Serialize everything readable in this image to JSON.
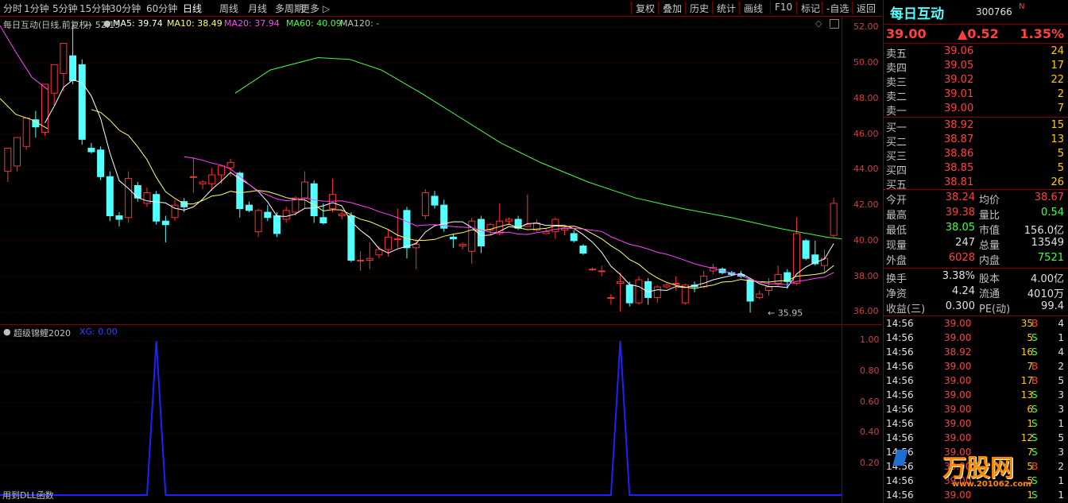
{
  "toolbar": {
    "periods": [
      "分时",
      "1分钟",
      "5分钟",
      "15分钟",
      "30分钟",
      "60分钟",
      "日线",
      "周线",
      "月线",
      "多周期",
      "更多 ▷"
    ],
    "tools": [
      "复权",
      "叠加",
      "历史",
      "统计",
      "画线",
      "F10",
      "标记",
      "-自选",
      "返回"
    ]
  },
  "main_chart": {
    "title": "每日互动(日线,前复权)",
    "ma": [
      {
        "label": "MA5: 39.74",
        "color": "#ffffff"
      },
      {
        "label": "MA10: 38.49",
        "color": "#ffff66"
      },
      {
        "label": "MA20: 37.94",
        "color": "#ff44ff"
      },
      {
        "label": "MA60: 40.09",
        "color": "#44ff44"
      },
      {
        "label": "MA120: -",
        "color": "#c0c0c0"
      }
    ],
    "price_ticks": [
      "52.00",
      "50.00",
      "48.00",
      "46.00",
      "44.00",
      "42.00",
      "40.00",
      "38.00",
      "36.00"
    ],
    "high_marker": "52.15",
    "low_marker": "35.95",
    "colors": {
      "up": "#ff3030",
      "down": "#54ffff",
      "ma5": "#ffffff",
      "ma10": "#ffff66",
      "ma20": "#ff44ff",
      "ma60": "#44ff44"
    }
  },
  "chart_data": {
    "type": "line",
    "title": "",
    "series": [
      {
        "name": "XG",
        "x": [
          1,
          2,
          3,
          4,
          5,
          6,
          7,
          8,
          9,
          10,
          11,
          12,
          13,
          14,
          15,
          16,
          17,
          18,
          19,
          20,
          21,
          22,
          23,
          24,
          25,
          26,
          27,
          28,
          29,
          30,
          31,
          32,
          33,
          34,
          35,
          36,
          37,
          38,
          39,
          40,
          41,
          42,
          43,
          44,
          45,
          46,
          47,
          48,
          49,
          50,
          51,
          52,
          53,
          54,
          55,
          56,
          57,
          58,
          59,
          60,
          61,
          62,
          63,
          64,
          65,
          66,
          67,
          68,
          69,
          70,
          71,
          72,
          73,
          74,
          75,
          76,
          77,
          78,
          79,
          80,
          81,
          82,
          83,
          84,
          85,
          86,
          87,
          88,
          89,
          90
        ],
        "values": [
          0,
          0,
          0,
          0,
          0,
          0,
          0,
          0,
          0,
          0,
          0,
          0,
          0,
          0,
          0,
          0,
          1,
          0,
          0,
          0,
          0,
          0,
          0,
          0,
          0,
          0,
          0,
          0,
          0,
          0,
          0,
          0,
          0,
          0,
          0,
          0,
          0,
          0,
          0,
          0,
          0,
          0,
          0,
          0,
          0,
          0,
          0,
          0,
          0,
          0,
          0,
          0,
          0,
          0,
          0,
          0,
          0,
          0,
          0,
          0,
          0,
          0,
          0,
          0,
          0,
          0,
          1,
          0,
          0,
          0,
          0,
          0,
          0,
          0,
          0,
          0,
          0,
          0,
          0,
          0,
          0,
          0,
          0,
          0,
          0,
          0,
          0,
          0,
          0,
          0
        ]
      }
    ],
    "ylim": [
      0,
      1.05
    ]
  },
  "indicator": {
    "title": "超级锦鲤2020",
    "xg_label": "XG: 0.00",
    "ticks": [
      "1.00",
      "0.80",
      "0.60",
      "0.40",
      "0.20"
    ],
    "footer": "用到DLL函数"
  },
  "quote": {
    "name": "每日互动",
    "code": "300766",
    "flag": "N",
    "price": "39.00",
    "change": "▲0.52",
    "pct": "1.35%",
    "asks": [
      {
        "label": "卖五",
        "price": "39.06",
        "vol": "24"
      },
      {
        "label": "卖四",
        "price": "39.05",
        "vol": "17"
      },
      {
        "label": "卖三",
        "price": "39.02",
        "vol": "22"
      },
      {
        "label": "卖二",
        "price": "39.01",
        "vol": "2"
      },
      {
        "label": "卖一",
        "price": "39.00",
        "vol": "7"
      }
    ],
    "bids": [
      {
        "label": "买一",
        "price": "38.92",
        "vol": "15"
      },
      {
        "label": "买二",
        "price": "38.87",
        "vol": "13"
      },
      {
        "label": "买三",
        "price": "38.86",
        "vol": "5"
      },
      {
        "label": "买四",
        "price": "38.85",
        "vol": "5"
      },
      {
        "label": "买五",
        "price": "38.81",
        "vol": "26"
      }
    ],
    "stats1": [
      {
        "l": "今开",
        "v": "38.24",
        "c": "#ff4040",
        "l2": "均价",
        "v2": "38.67",
        "c2": "#ff4040"
      },
      {
        "l": "最高",
        "v": "39.38",
        "c": "#ff4040",
        "l2": "量比",
        "v2": "0.54",
        "c2": "#44ff44"
      },
      {
        "l": "最低",
        "v": "38.05",
        "c": "#44ff44",
        "l2": "市值",
        "v2": "156.0亿",
        "c2": "#e0e0e0"
      },
      {
        "l": "现量",
        "v": "247",
        "c": "#e0e0e0",
        "l2": "总量",
        "v2": "13549",
        "c2": "#e0e0e0"
      },
      {
        "l": "外盘",
        "v": "6028",
        "c": "#ff4040",
        "l2": "内盘",
        "v2": "7521",
        "c2": "#44ff44"
      }
    ],
    "stats2": [
      {
        "l": "换手",
        "v": "3.38%",
        "c": "#e0e0e0",
        "l2": "股本",
        "v2": "4.00亿",
        "c2": "#e0e0e0"
      },
      {
        "l": "净资",
        "v": "4.24",
        "c": "#e0e0e0",
        "l2": "流通",
        "v2": "4010万",
        "c2": "#e0e0e0"
      },
      {
        "l": "收益(三)",
        "v": "0.300",
        "c": "#e0e0e0",
        "l2": "PE(动)",
        "v2": "99.4",
        "c2": "#e0e0e0"
      }
    ],
    "ticks": [
      {
        "t": "14:56",
        "p": "39.00",
        "v": "35",
        "s": "B",
        "n": "4"
      },
      {
        "t": "14:56",
        "p": "39.00",
        "v": "5",
        "s": "S",
        "n": "1"
      },
      {
        "t": "14:56",
        "p": "38.92",
        "v": "16",
        "s": "S",
        "n": "4"
      },
      {
        "t": "14:56",
        "p": "39.00",
        "v": "7",
        "s": "B",
        "n": "2"
      },
      {
        "t": "14:56",
        "p": "39.00",
        "v": "17",
        "s": "B",
        "n": "5"
      },
      {
        "t": "14:56",
        "p": "39.00",
        "v": "13",
        "s": "S",
        "n": "3"
      },
      {
        "t": "14:56",
        "p": "39.00",
        "v": "6",
        "s": "S",
        "n": "3"
      },
      {
        "t": "14:56",
        "p": "39.00",
        "v": "1",
        "s": "S",
        "n": "1"
      },
      {
        "t": "14:56",
        "p": "39.00",
        "v": "12",
        "s": "S",
        "n": "5"
      },
      {
        "t": "14:56",
        "p": "39.00",
        "v": "7",
        "s": "S",
        "n": "3"
      },
      {
        "t": "14:56",
        "p": "39.00",
        "v": "5",
        "s": "B",
        "n": "2"
      },
      {
        "t": "14:56",
        "p": "39.00",
        "v": "5",
        "s": "S",
        "n": "1"
      },
      {
        "t": "14:56",
        "p": "39.00",
        "v": "1",
        "s": "S",
        "n": "1"
      }
    ],
    "watermark": {
      "brand": "万股网",
      "site": "www.201062.com"
    }
  }
}
